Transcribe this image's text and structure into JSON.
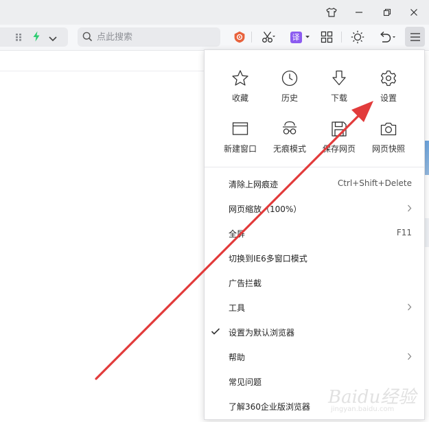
{
  "toolbar": {
    "search_placeholder": "点此搜索",
    "translate_badge": "译"
  },
  "menu": {
    "grid": [
      {
        "icon": "star-icon",
        "label": "收藏"
      },
      {
        "icon": "clock-icon",
        "label": "历史"
      },
      {
        "icon": "download-icon",
        "label": "下载"
      },
      {
        "icon": "gear-icon",
        "label": "设置"
      },
      {
        "icon": "new-window-icon",
        "label": "新建窗口"
      },
      {
        "icon": "incognito-icon",
        "label": "无痕模式"
      },
      {
        "icon": "save-page-icon",
        "label": "保存网页"
      },
      {
        "icon": "camera-icon",
        "label": "网页快照"
      }
    ],
    "items": [
      {
        "label": "清除上网痕迹",
        "shortcut": "Ctrl+Shift+Delete"
      },
      {
        "label": "网页缩放（100%）",
        "submenu": true
      },
      {
        "label": "全屏",
        "shortcut": "F11"
      },
      {
        "label": "切换到IE6多窗口模式"
      },
      {
        "label": "广告拦截"
      },
      {
        "label": "工具",
        "submenu": true
      },
      {
        "label": "设置为默认浏览器",
        "checked": true
      },
      {
        "label": "帮助",
        "submenu": true
      },
      {
        "label": "常见问题"
      },
      {
        "label": "了解360企业版浏览器"
      }
    ]
  },
  "watermark": {
    "text": "Baidu经验",
    "url": "jingyan.baidu.com"
  },
  "colors": {
    "accent_green": "#2ecc71",
    "translate_purple": "#8c5cf0",
    "ext_orange": "#e8623c",
    "annotation_red": "#e23b3b"
  }
}
